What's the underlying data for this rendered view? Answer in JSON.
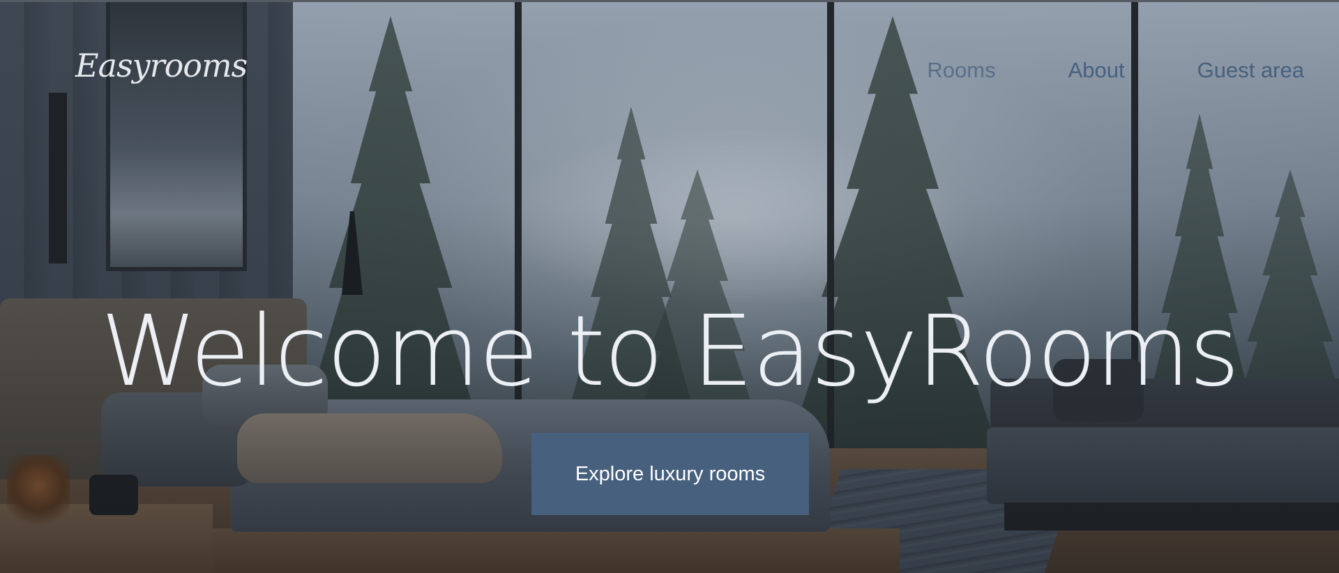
{
  "brand": {
    "logo_text": "Easyrooms"
  },
  "nav": {
    "items": [
      {
        "label": "Rooms"
      },
      {
        "label": "About"
      },
      {
        "label": "Guest area"
      }
    ]
  },
  "hero": {
    "headline": "Welcome to EasyRooms",
    "cta_label": "Explore luxury rooms",
    "background_description_icon": "bedroom-forest-view-image"
  },
  "colors": {
    "accent": "#46607e",
    "headline": "#eceff4",
    "logo": "#e6e9ee"
  }
}
